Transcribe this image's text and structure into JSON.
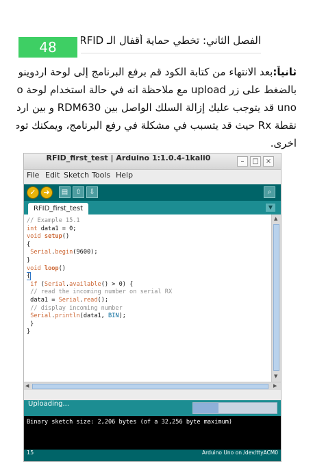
{
  "page": {
    "number": "48",
    "accent": "#3ecf64"
  },
  "chapter": {
    "title": "الفصل الثاني: تخطي حماية أقفال الـ RFID"
  },
  "paragraph": {
    "lead": "ثانياً:",
    "lines": [
      "بعد الانتهاء من كتابة الكود قم برفع البرنامج إلى لوحة اردوينو وذلك",
      "بالضغط على زر upload مع ملاحظة انه في حالة استخدام لوحة arduino",
      "uno قد يتوجب عليك إزالة السلك الواصل بين RDM630 و بين اردوينو على",
      "نقطة Rx حيث قد يتسبب في مشكلة في رفع البرنامج، ويمكنك توصيله مرة",
      "اخرى."
    ]
  },
  "ide": {
    "window_title": "RFID_first_test | Arduino 1:1.0.4-1kali0",
    "window_buttons": [
      "–",
      "□",
      "×"
    ],
    "menu": [
      "File",
      "Edit",
      "Sketch",
      "Tools",
      "Help"
    ],
    "toolbar": [
      {
        "icon": "verify-icon",
        "glyph": "✓"
      },
      {
        "icon": "upload-icon",
        "glyph": "➜"
      },
      {
        "icon": "new-icon",
        "glyph": "▤"
      },
      {
        "icon": "open-icon",
        "glyph": "⇧"
      },
      {
        "icon": "save-icon",
        "glyph": "⇩"
      },
      {
        "icon": "serial-monitor-icon",
        "glyph": "⌕"
      }
    ],
    "tab_label": "RFID_first_test",
    "tab_menu_glyph": "▼",
    "code": [
      [
        [
          "cm",
          "// Example 15.1"
        ]
      ],
      [
        [
          "kw",
          "int"
        ],
        [
          "",
          " data1 = 0;"
        ]
      ],
      [
        [
          "kw",
          "void"
        ],
        [
          "",
          " "
        ],
        [
          "fn",
          "setup"
        ],
        [
          "",
          "()"
        ]
      ],
      [
        [
          "",
          "{"
        ]
      ],
      [
        [
          "",
          " "
        ],
        [
          "lib",
          "Serial"
        ],
        [
          "",
          "."
        ],
        [
          "lib",
          "begin"
        ],
        [
          "",
          "(9600);"
        ]
      ],
      [
        [
          "",
          "}"
        ]
      ],
      [
        [
          "kw",
          "void"
        ],
        [
          "",
          " "
        ],
        [
          "fn",
          "loop"
        ],
        [
          "",
          "()"
        ]
      ],
      [
        [
          "cursor",
          "{"
        ]
      ],
      [
        [
          "",
          " "
        ],
        [
          "kw",
          "if"
        ],
        [
          "",
          " ("
        ],
        [
          "lib",
          "Serial"
        ],
        [
          "",
          "."
        ],
        [
          "lib",
          "available"
        ],
        [
          "",
          "() > 0) {"
        ]
      ],
      [
        [
          "",
          " "
        ],
        [
          "cm",
          "// read the incoming number on serial RX"
        ]
      ],
      [
        [
          "",
          " data1 = "
        ],
        [
          "lib",
          "Serial"
        ],
        [
          "",
          "."
        ],
        [
          "lib",
          "read"
        ],
        [
          "",
          "();"
        ]
      ],
      [
        [
          "",
          " "
        ],
        [
          "cm",
          "// display incoming number"
        ]
      ],
      [
        [
          "",
          " "
        ],
        [
          "lib",
          "Serial"
        ],
        [
          "",
          "."
        ],
        [
          "lib",
          "println"
        ],
        [
          "",
          "(data1, "
        ],
        [
          "cn",
          "BIN"
        ],
        [
          "",
          ");"
        ]
      ],
      [
        [
          "",
          " }"
        ]
      ],
      [
        [
          "",
          "}"
        ]
      ]
    ],
    "status": "Uploading...",
    "upload_progress": 0.3,
    "console": "Binary sketch size: 2,206 bytes (of a 32,256 byte maximum)",
    "footer_line": "15",
    "footer_board": "Arduino Uno on /dev/ttyACM0",
    "colors": {
      "toolbar": "#006468",
      "tabbar": "#1c8d92",
      "console": "#000000"
    }
  }
}
